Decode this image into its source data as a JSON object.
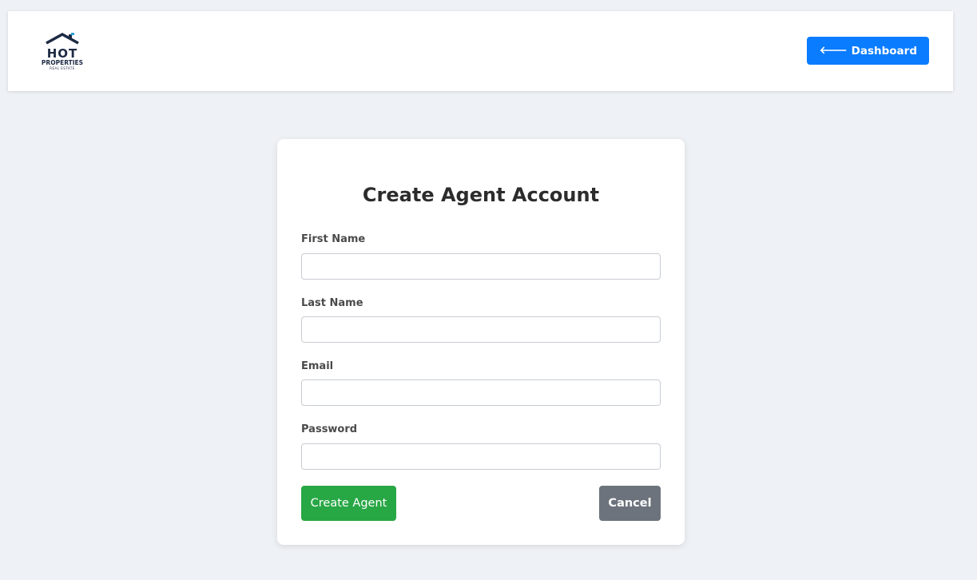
{
  "header": {
    "logo": {
      "word_hot": "HOT",
      "word_properties": "PROPERTIES",
      "word_real_estate": "REAL ESTATE",
      "icon": "house-logo-icon",
      "brand_color": "#1d2a44",
      "accent_color": "#2a9fd6"
    },
    "dashboard_button": {
      "label": "Dashboard",
      "icon": "arrow-left-icon",
      "color": "#0a7cff"
    }
  },
  "form": {
    "title": "Create Agent Account",
    "fields": [
      {
        "label": "First Name",
        "value": "",
        "placeholder": ""
      },
      {
        "label": "Last Name",
        "value": "",
        "placeholder": ""
      },
      {
        "label": "Email",
        "value": "",
        "placeholder": ""
      },
      {
        "label": "Password",
        "value": "",
        "placeholder": ""
      }
    ],
    "submit_button": {
      "label": "Create Agent",
      "color": "#28a745"
    },
    "cancel_button": {
      "label": "Cancel",
      "color": "#6c737c"
    }
  },
  "colors": {
    "page_background": "#eef1f5",
    "card_background": "#ffffff"
  }
}
